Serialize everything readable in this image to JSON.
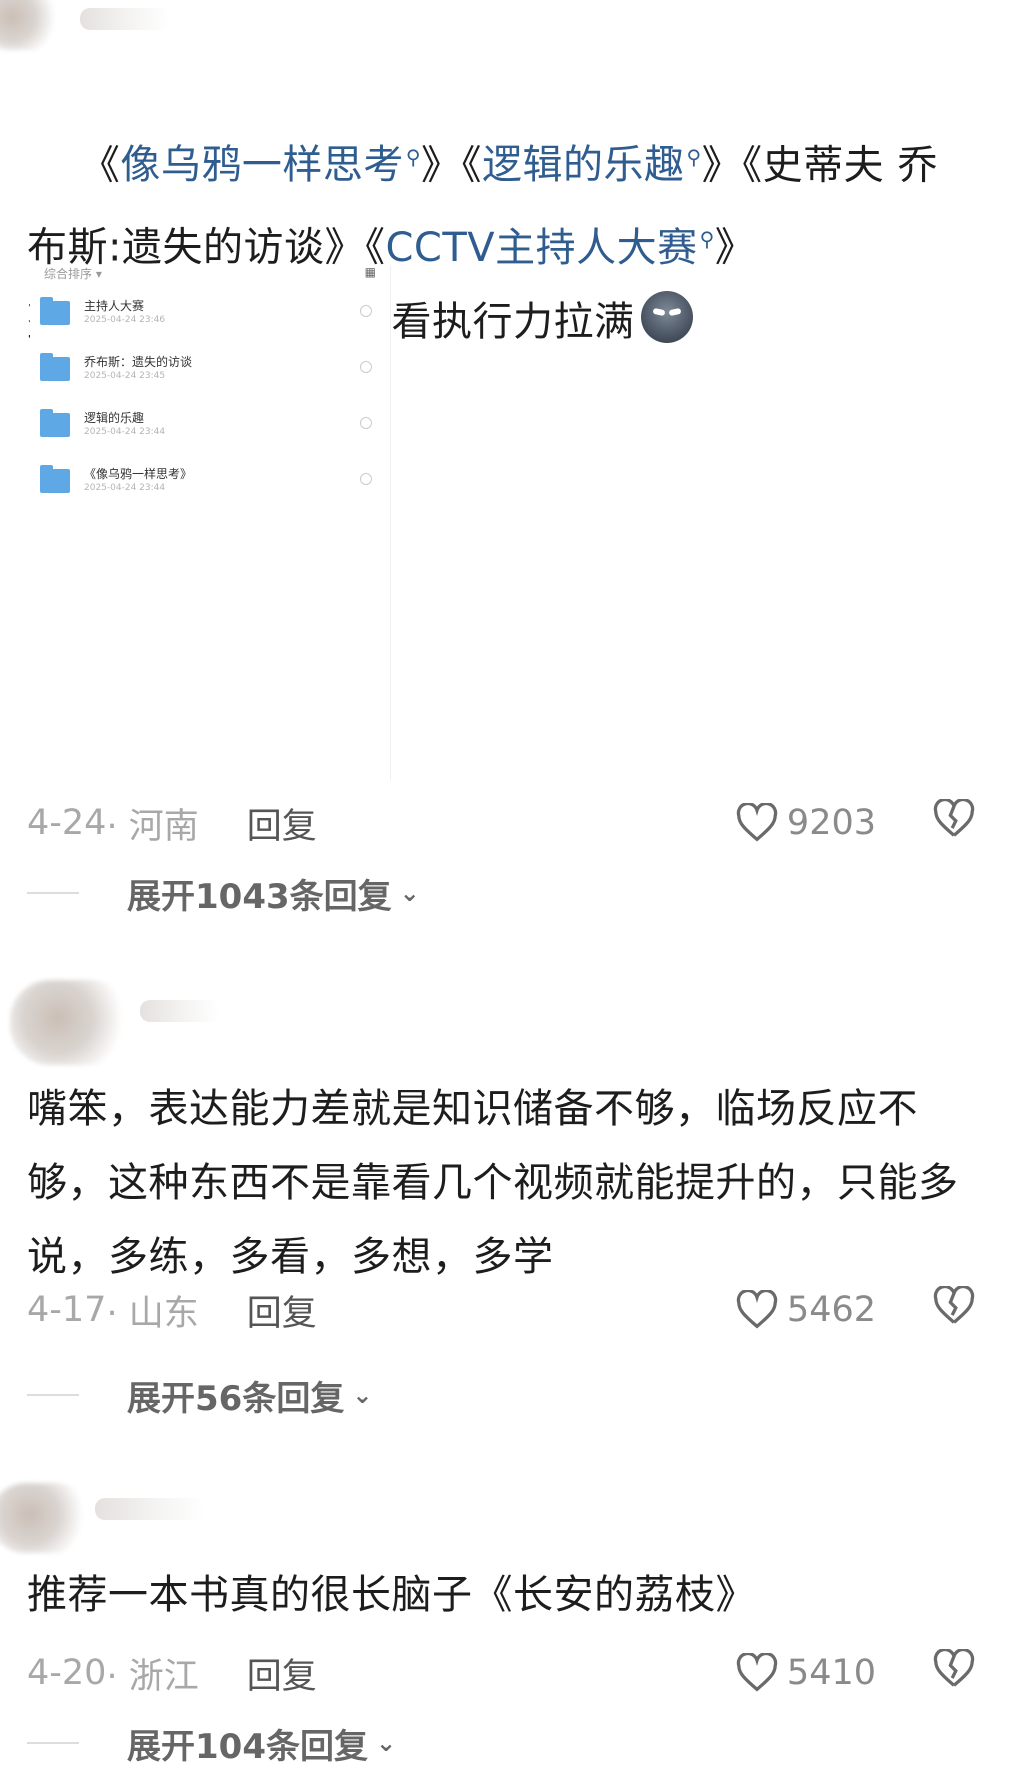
{
  "comments": [
    {
      "segments": [
        "《",
        "像乌鸦一样思考",
        "》《",
        "逻辑的乐趣",
        "》《史蒂夫 乔布斯:遗失的访谈》《",
        "CCTV主持人大赛",
        "》\n整理好了，每天晚上看执行力拉满"
      ],
      "date": "4-24",
      "region": "· 河南",
      "reply": "回复",
      "likes": "9203",
      "expand": "展开1043条回复"
    },
    {
      "text": "嘴笨，表达能力差就是知识储备不够，临场反应不够，这种东西不是靠看几个视频就能提升的，只能多说，多练，多看，多想，多学",
      "date": "4-17",
      "region": "· 山东",
      "reply": "回复",
      "likes": "5462",
      "expand": "展开56条回复"
    },
    {
      "text": "推荐一本书真的很长脑子《长安的荔枝》",
      "date": "4-20",
      "region": "· 浙江",
      "reply": "回复",
      "likes": "5410",
      "expand": "展开104条回复"
    }
  ],
  "attachment": {
    "sort_label": "综合排序 ▾",
    "files": [
      {
        "name": "主持人大赛",
        "date": "2025-04-24 23:46"
      },
      {
        "name": "乔布斯：遗失的访谈",
        "date": "2025-04-24 23:45"
      },
      {
        "name": "逻辑的乐趣",
        "date": "2025-04-24 23:44"
      },
      {
        "name": "《像乌鸦一样思考》",
        "date": "2025-04-24 23:44"
      }
    ]
  },
  "icons": {
    "search": "search-icon",
    "like": "heart-outline-icon",
    "dislike": "broken-heart-icon",
    "expand": "chevron-down-icon",
    "emoji": "wolf-emoji-icon",
    "folder": "folder-icon"
  },
  "colors": {
    "link": "#2f5d8f",
    "meta_text": "#a8a8a8",
    "folder": "#5fa8e6"
  }
}
